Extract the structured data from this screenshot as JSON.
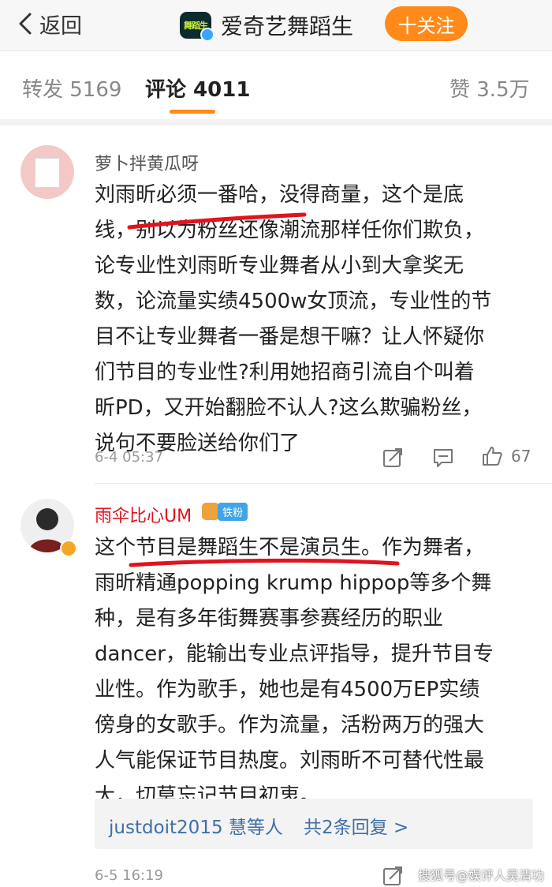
{
  "header": {
    "back_label": "返回",
    "account_name": "爱奇艺舞蹈生",
    "logo_text": "舞蹈生",
    "follow_label": "十关注"
  },
  "tabs": {
    "repost": "转发 5169",
    "comment": "评论 4011",
    "like": "赞 3.5万"
  },
  "comments": [
    {
      "username": "萝卜拌黄瓜呀",
      "lines": [
        "刘雨昕必须一番哈，没得商量，这个是底",
        "线，别以为粉丝还像潮流那样任你们欺负，",
        "论专业性刘雨昕专业舞者从小到大拿奖无",
        "数，论流量实绩4500w女顶流，专业性的节",
        "目不让专业舞者一番是想干嘛？让人怀疑你",
        "们节目的专业性?利用她招商引流自个叫着",
        "昕PD，又开始翻脸不认人?这么欺骗粉丝，",
        "说句不要脸送给你们了"
      ],
      "time": "6-4 05:37",
      "likes": "67"
    },
    {
      "username": "雨伞比心UM",
      "badge": "铁粉",
      "lines": [
        "这个节目是舞蹈生不是演员生。作为舞者，",
        "雨昕精通popping krump hippop等多个舞",
        "种，是有多年街舞赛事参赛经历的职业",
        "dancer，能输出专业点评指导，提升节目专",
        "业性。作为歌手，她也是有4500万EP实绩",
        "傍身的女歌手。作为流量，活粉两万的强大",
        "人气能保证节目热度。刘雨昕不可替代性最",
        "大，切莫忘记节目初衷。"
      ],
      "replies_who": "justdoit2015 慧等人",
      "replies_count": "共2条回复 >",
      "time": "6-5 16:19"
    }
  ],
  "watermark": "搜狐号@娱评人吴清功",
  "colors": {
    "accent": "#ff8a1a",
    "link": "#3f6fa8",
    "underline_mark": "#e0141e"
  }
}
